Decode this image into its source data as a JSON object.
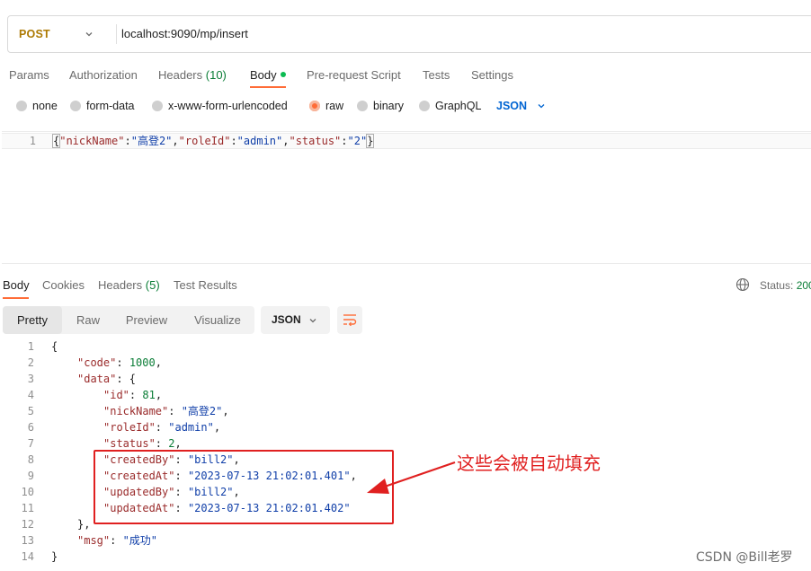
{
  "request": {
    "method": "POST",
    "url": "localhost:9090/mp/insert"
  },
  "request_tabs": [
    {
      "label": "Params"
    },
    {
      "label": "Authorization"
    },
    {
      "label": "Headers",
      "count": "(10)"
    },
    {
      "label": "Body",
      "active": true
    },
    {
      "label": "Pre-request Script"
    },
    {
      "label": "Tests"
    },
    {
      "label": "Settings"
    }
  ],
  "body_modes": {
    "options": [
      "none",
      "form-data",
      "x-www-form-urlencoded",
      "raw",
      "binary",
      "GraphQL"
    ],
    "selected": "raw",
    "language": "JSON"
  },
  "request_body": {
    "line_number": "1",
    "text": "{\"nickName\":\"高登2\",\"roleId\":\"admin\",\"status\":\"2\"}"
  },
  "response_tabs": [
    {
      "label": "Body",
      "active": true
    },
    {
      "label": "Cookies"
    },
    {
      "label": "Headers",
      "count": "(5)"
    },
    {
      "label": "Test Results"
    }
  ],
  "status": {
    "label": "Status:",
    "value": "200"
  },
  "view_modes": {
    "options": [
      "Pretty",
      "Raw",
      "Preview",
      "Visualize"
    ],
    "selected": "Pretty",
    "format": "JSON"
  },
  "response_lines": [
    {
      "n": "1",
      "indent": 0,
      "parts": [
        [
          "p",
          "{"
        ]
      ]
    },
    {
      "n": "2",
      "indent": 1,
      "parts": [
        [
          "k",
          "\"code\""
        ],
        [
          "p",
          ": "
        ],
        [
          "n",
          "1000"
        ],
        [
          "p",
          ","
        ]
      ]
    },
    {
      "n": "3",
      "indent": 1,
      "parts": [
        [
          "k",
          "\"data\""
        ],
        [
          "p",
          ": {"
        ]
      ]
    },
    {
      "n": "4",
      "indent": 2,
      "parts": [
        [
          "k",
          "\"id\""
        ],
        [
          "p",
          ": "
        ],
        [
          "n",
          "81"
        ],
        [
          "p",
          ","
        ]
      ]
    },
    {
      "n": "5",
      "indent": 2,
      "parts": [
        [
          "k",
          "\"nickName\""
        ],
        [
          "p",
          ": "
        ],
        [
          "s",
          "\"高登2\""
        ],
        [
          "p",
          ","
        ]
      ]
    },
    {
      "n": "6",
      "indent": 2,
      "parts": [
        [
          "k",
          "\"roleId\""
        ],
        [
          "p",
          ": "
        ],
        [
          "s",
          "\"admin\""
        ],
        [
          "p",
          ","
        ]
      ]
    },
    {
      "n": "7",
      "indent": 2,
      "parts": [
        [
          "k",
          "\"status\""
        ],
        [
          "p",
          ": "
        ],
        [
          "n",
          "2"
        ],
        [
          "p",
          ","
        ]
      ]
    },
    {
      "n": "8",
      "indent": 2,
      "parts": [
        [
          "k",
          "\"createdBy\""
        ],
        [
          "p",
          ": "
        ],
        [
          "s",
          "\"bill2\""
        ],
        [
          "p",
          ","
        ]
      ]
    },
    {
      "n": "9",
      "indent": 2,
      "parts": [
        [
          "k",
          "\"createdAt\""
        ],
        [
          "p",
          ": "
        ],
        [
          "s",
          "\"2023-07-13 21:02:01.401\""
        ],
        [
          "p",
          ","
        ]
      ]
    },
    {
      "n": "10",
      "indent": 2,
      "parts": [
        [
          "k",
          "\"updatedBy\""
        ],
        [
          "p",
          ": "
        ],
        [
          "s",
          "\"bill2\""
        ],
        [
          "p",
          ","
        ]
      ]
    },
    {
      "n": "11",
      "indent": 2,
      "parts": [
        [
          "k",
          "\"updatedAt\""
        ],
        [
          "p",
          ": "
        ],
        [
          "s",
          "\"2023-07-13 21:02:01.402\""
        ]
      ]
    },
    {
      "n": "12",
      "indent": 1,
      "parts": [
        [
          "p",
          "},"
        ]
      ]
    },
    {
      "n": "13",
      "indent": 1,
      "parts": [
        [
          "k",
          "\"msg\""
        ],
        [
          "p",
          ": "
        ],
        [
          "s",
          "\"成功\""
        ]
      ]
    },
    {
      "n": "14",
      "indent": 0,
      "parts": [
        [
          "p",
          "}"
        ]
      ]
    }
  ],
  "annotation": {
    "text": "这些会被自动填充",
    "color": "#e02020"
  },
  "watermark": "CSDN @Bill老罗",
  "colors": {
    "accent": "#ff6c37",
    "method": "#ad7a03",
    "link": "#0265d2",
    "success": "#0a7d36"
  }
}
